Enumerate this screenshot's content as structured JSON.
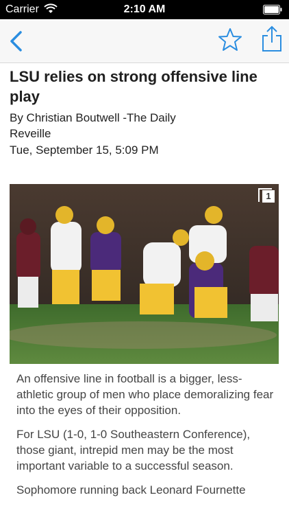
{
  "status_bar": {
    "carrier": "Carrier",
    "time": "2:10 AM"
  },
  "nav": {
    "back_icon": "chevron-left-icon",
    "favorite_icon": "star-icon",
    "share_icon": "share-icon",
    "accent_color": "#2a8de0"
  },
  "article": {
    "headline": "LSU relies on strong offensive line play",
    "byline": "By Christian Boutwell -The Daily Reveille",
    "date": "Tue, September 15, 5:09 PM",
    "photo": {
      "badge_count": "1"
    },
    "paragraphs": [
      "An offensive line in football is a bigger, less-athletic group of men who place demoralizing fear into the eyes of their opposition.",
      "For LSU (1-0, 1-0 Southeastern Conference), those giant, intrepid men may be the most important variable to a successful season.",
      "Sophomore running back Leonard Fournette"
    ]
  }
}
